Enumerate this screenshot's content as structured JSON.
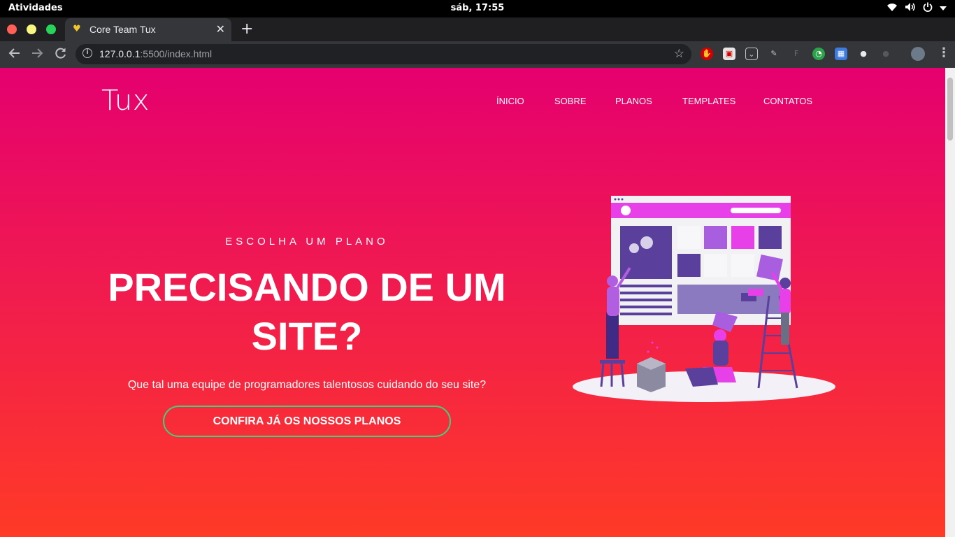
{
  "os": {
    "activities": "Atividades",
    "clock": "sáb, 17:55"
  },
  "browser": {
    "tab_title": "Core Team Tux",
    "new_tab": "+",
    "url_host": "127.0.0.1",
    "url_path": ":5500/index.html"
  },
  "site": {
    "logo": "Tux",
    "nav": [
      "ÍNICIO",
      "SOBRE",
      "PLANOS",
      "TEMPLATES",
      "CONTATOS"
    ],
    "kicker": "ESCOLHA UM PLANO",
    "headline_line1": "PRECISANDO DE UM",
    "headline_line2": "SITE?",
    "subtitle": "Que tal uma equipe de programadores talentosos cuidando do seu site?",
    "cta": "CONFIRA JÁ OS NOSSOS PLANOS"
  },
  "colors": {
    "gradient_top": "#e5006f",
    "gradient_bottom": "#ff3a26",
    "cta_border": "#3fd17c"
  }
}
